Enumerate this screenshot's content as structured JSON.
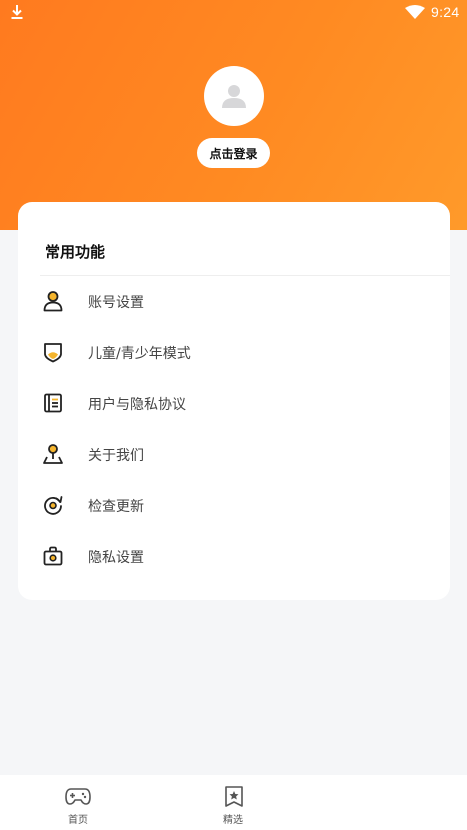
{
  "status_bar": {
    "time": "9:24",
    "icons": [
      "download-icon",
      "wifi-icon"
    ]
  },
  "profile": {
    "avatar_icon": "user-avatar-icon",
    "login_label": "点击登录"
  },
  "features": {
    "title": "常用功能",
    "items": [
      {
        "label": "账号设置",
        "icon": "person-icon"
      },
      {
        "label": "儿童/青少年模式",
        "icon": "shield-icon"
      },
      {
        "label": "用户与隐私协议",
        "icon": "document-icon"
      },
      {
        "label": "关于我们",
        "icon": "location-pin-icon"
      },
      {
        "label": "检查更新",
        "icon": "refresh-icon"
      },
      {
        "label": "隐私设置",
        "icon": "lock-bag-icon"
      }
    ]
  },
  "bottom_nav": {
    "tabs": [
      {
        "label": "首页",
        "icon": "gamepad-icon"
      },
      {
        "label": "精选",
        "icon": "star-bookmark-icon"
      }
    ]
  },
  "colors": {
    "accent_orange": "#ff8a22",
    "icon_yellow": "#f5b52e",
    "icon_dark": "#222222"
  }
}
